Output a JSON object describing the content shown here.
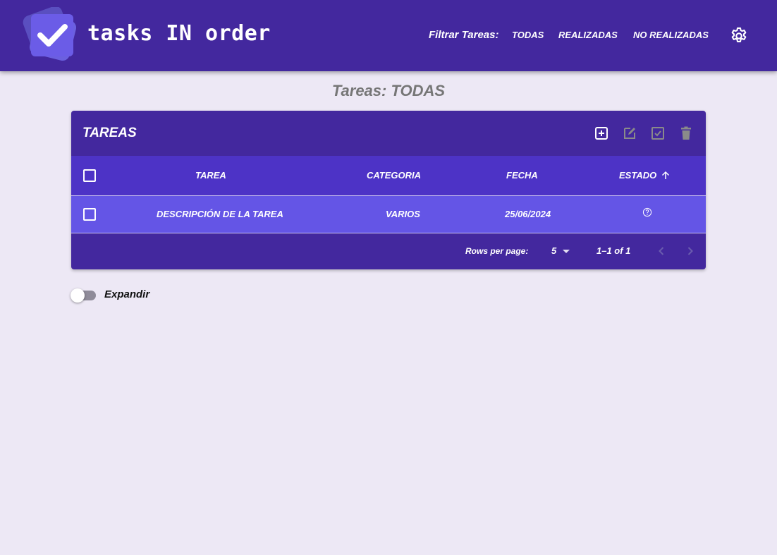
{
  "app": {
    "title": "tasks IN order"
  },
  "filter": {
    "label": "Filtrar Tareas:",
    "options": [
      "TODAS",
      "REALIZADAS",
      "NO REALIZADAS"
    ]
  },
  "page_heading": "Tareas: TODAS",
  "table": {
    "title": "TAREAS",
    "toolbar_icons": [
      "add-box-icon",
      "edit-icon",
      "check-box-icon",
      "delete-icon"
    ],
    "columns": [
      "TAREA",
      "CATEGORIA",
      "FECHA",
      "ESTADO"
    ],
    "sort_indicator": "arrow-up-icon",
    "rows": [
      {
        "tarea": "DESCRIPCIÓN DE LA TAREA",
        "categoria": "VARIOS",
        "fecha": "25/06/2024",
        "estado_icon": "help-circle-icon"
      }
    ]
  },
  "pagination": {
    "rows_per_page_label": "Rows per page:",
    "rows_per_page": "5",
    "range": "1–1 of 1"
  },
  "expand_toggle": {
    "label": "Expandir",
    "on": false
  },
  "colors": {
    "appbar": "#43289e",
    "table_header": "#4d33c6",
    "row": "#6455e6",
    "background": "#ede8f5",
    "logo_accent": "#6b5ce7"
  }
}
